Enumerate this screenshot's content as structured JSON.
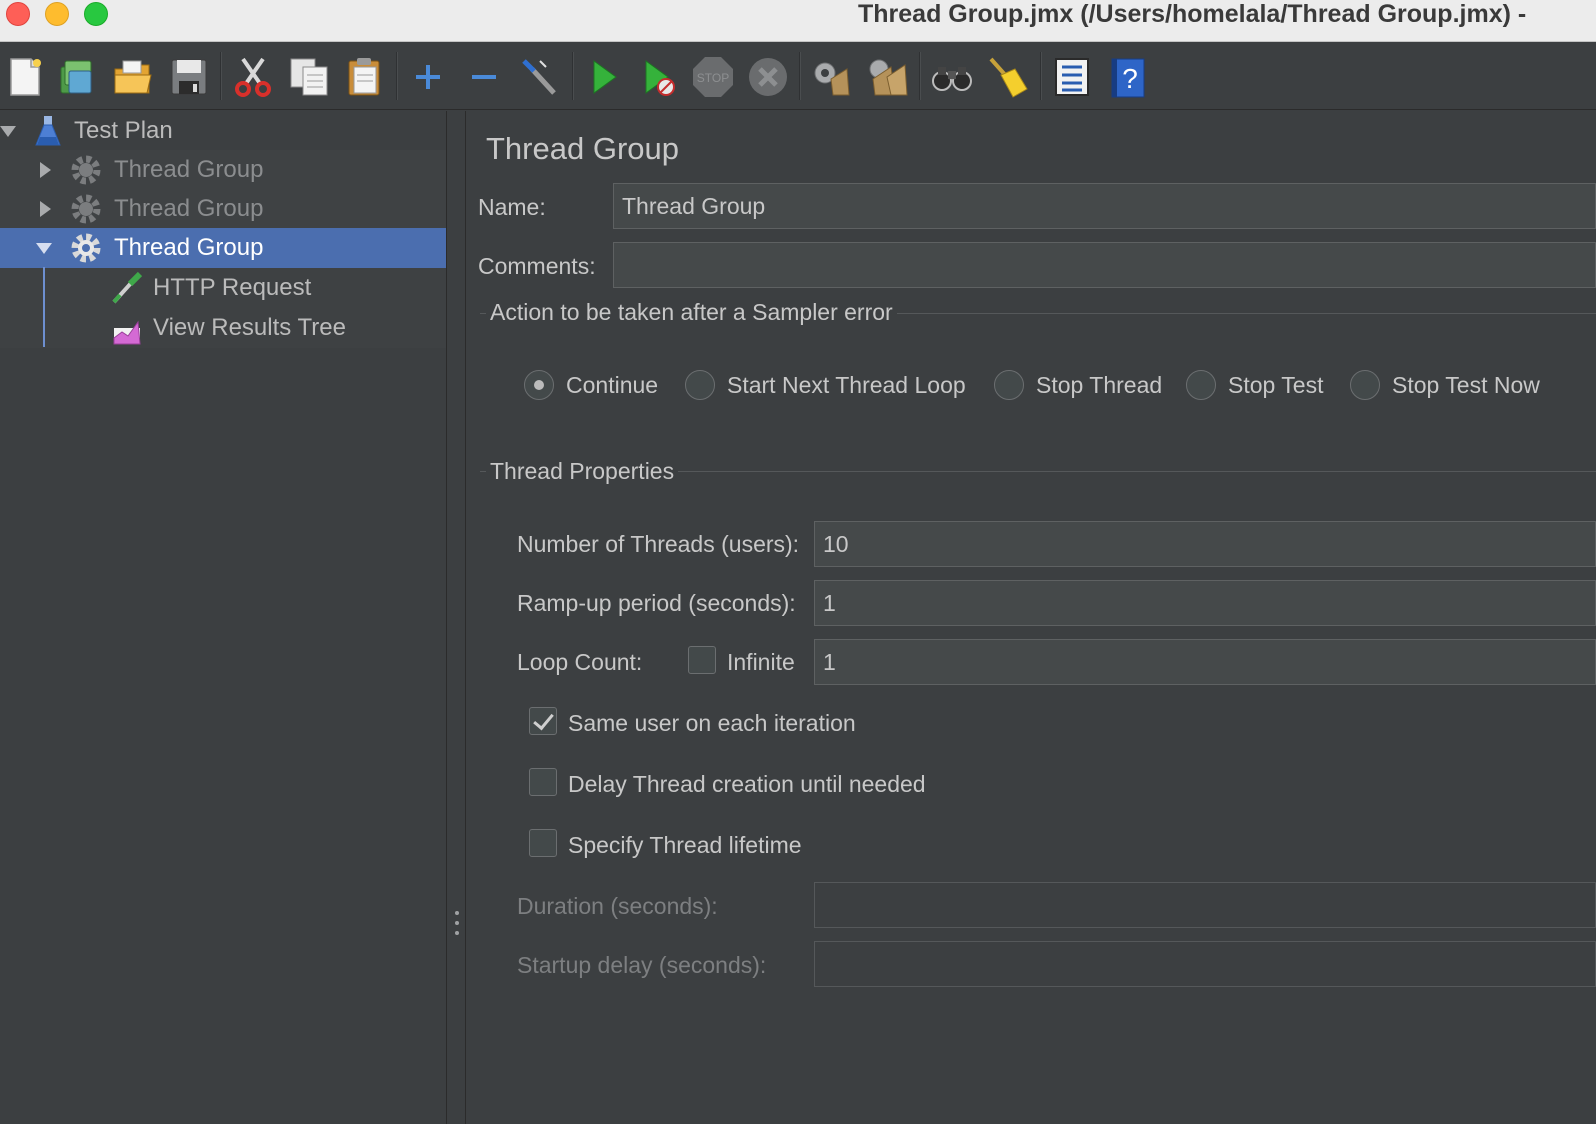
{
  "window": {
    "title": "Thread Group.jmx (/Users/homelala/Thread Group.jmx) -"
  },
  "toolbar": {
    "buttons": [
      {
        "name": "new",
        "icon": "new-file-icon"
      },
      {
        "name": "templates",
        "icon": "templates-icon"
      },
      {
        "name": "open",
        "icon": "open-folder-icon"
      },
      {
        "name": "save",
        "icon": "save-disk-icon"
      },
      {
        "name": "cut",
        "icon": "scissors-icon"
      },
      {
        "name": "copy",
        "icon": "copy-icon"
      },
      {
        "name": "paste",
        "icon": "paste-icon"
      },
      {
        "name": "expand",
        "icon": "plus-icon"
      },
      {
        "name": "collapse",
        "icon": "minus-icon"
      },
      {
        "name": "toggle",
        "icon": "wand-icon"
      },
      {
        "name": "start",
        "icon": "play-icon"
      },
      {
        "name": "start-no-pauses",
        "icon": "play-no-timers-icon"
      },
      {
        "name": "stop",
        "icon": "stop-icon"
      },
      {
        "name": "shutdown",
        "icon": "shutdown-icon"
      },
      {
        "name": "clear",
        "icon": "clear-broom-icon"
      },
      {
        "name": "clear-all",
        "icon": "clear-all-broom-icon"
      },
      {
        "name": "search",
        "icon": "binoculars-icon"
      },
      {
        "name": "reset-search",
        "icon": "reset-search-broom-icon"
      },
      {
        "name": "function-helper",
        "icon": "function-list-icon"
      },
      {
        "name": "help",
        "icon": "help-icon"
      }
    ],
    "stop_label": "STOP"
  },
  "tree": {
    "items": [
      {
        "label": "Test Plan",
        "icon": "flask-icon",
        "state": "expanded"
      },
      {
        "label": "Thread Group",
        "icon": "gear-icon",
        "state": "collapsed-disabled"
      },
      {
        "label": "Thread Group",
        "icon": "gear-icon",
        "state": "collapsed-disabled"
      },
      {
        "label": "Thread Group",
        "icon": "gear-icon",
        "state": "expanded-selected"
      },
      {
        "label": "HTTP Request",
        "icon": "pipette-icon",
        "state": "leaf"
      },
      {
        "label": "View Results Tree",
        "icon": "chart-icon",
        "state": "leaf"
      }
    ]
  },
  "panel": {
    "title": "Thread Group",
    "name_label": "Name:",
    "name_value": "Thread Group",
    "comments_label": "Comments:",
    "comments_value": "",
    "error_group_title": "Action to be taken after a Sampler error",
    "error_actions": [
      {
        "label": "Continue",
        "selected": true
      },
      {
        "label": "Start Next Thread Loop",
        "selected": false
      },
      {
        "label": "Stop Thread",
        "selected": false
      },
      {
        "label": "Stop Test",
        "selected": false
      },
      {
        "label": "Stop Test Now",
        "selected": false
      }
    ],
    "props_group_title": "Thread Properties",
    "threads_label": "Number of Threads (users):",
    "threads_value": "10",
    "rampup_label": "Ramp-up period (seconds):",
    "rampup_value": "1",
    "loop_label": "Loop Count:",
    "infinite_label": "Infinite",
    "infinite_checked": false,
    "loop_value": "1",
    "same_user_label": "Same user on each iteration",
    "same_user_checked": true,
    "delay_label": "Delay Thread creation until needed",
    "delay_checked": false,
    "lifetime_label": "Specify Thread lifetime",
    "lifetime_checked": false,
    "duration_label": "Duration (seconds):",
    "duration_value": "",
    "startup_label": "Startup delay (seconds):",
    "startup_value": ""
  },
  "colors": {
    "selection": "#4b6eaf",
    "background": "#3c3f41",
    "field": "#45494a"
  }
}
